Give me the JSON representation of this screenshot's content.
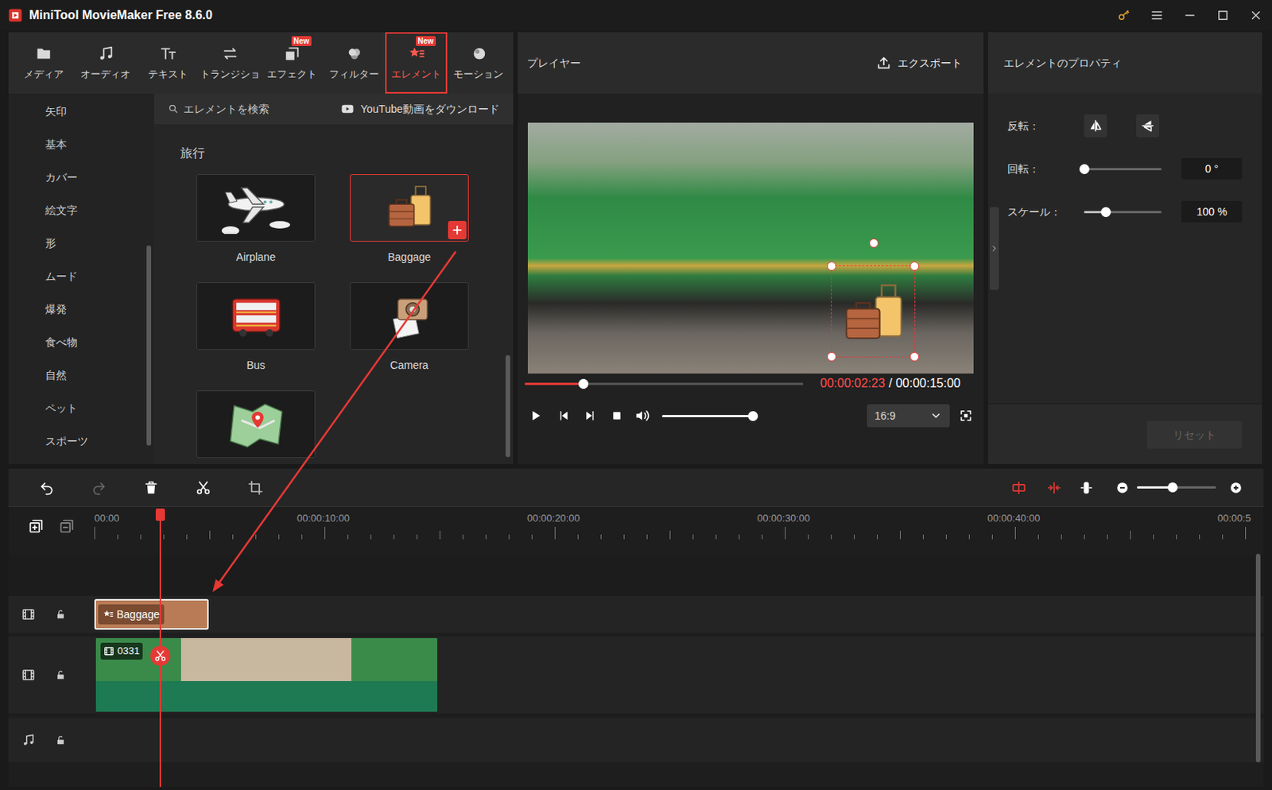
{
  "window": {
    "title": "MiniTool MovieMaker Free 8.6.0"
  },
  "toolbar": {
    "items": [
      {
        "label": "メディア",
        "selected": false
      },
      {
        "label": "オーディオ",
        "selected": false
      },
      {
        "label": "テキスト",
        "selected": false
      },
      {
        "label": "トランジショ",
        "selected": false
      },
      {
        "label": "エフェクト",
        "badge": "New",
        "selected": false
      },
      {
        "label": "フィルター",
        "selected": false
      },
      {
        "label": "エレメント",
        "badge": "New",
        "selected": true
      },
      {
        "label": "モーション",
        "selected": false
      }
    ]
  },
  "categories": {
    "items": [
      "矢印",
      "基本",
      "カバー",
      "絵文字",
      "形",
      "ムード",
      "爆発",
      "食べ物",
      "自然",
      "ペット",
      "スポーツ"
    ],
    "scroll": {
      "position": 0.41,
      "size": 0.54
    }
  },
  "library": {
    "search": {
      "placeholder": "エレメントを検索"
    },
    "download": "YouTube動画をダウンロード",
    "section": "旅行",
    "cards": [
      {
        "label": "Airplane",
        "selected": false
      },
      {
        "label": "Baggage",
        "selected": true
      },
      {
        "label": "Bus",
        "selected": false
      },
      {
        "label": "Camera",
        "selected": false
      },
      {
        "selected": false
      }
    ],
    "scroll": {
      "position": 0.68,
      "size": 0.3
    }
  },
  "player": {
    "title": "プレイヤー",
    "export": "エクスポート",
    "progress": 0.21,
    "current": "00:00:02:23",
    "total": "/ 00:00:15:00",
    "volume": 0.95,
    "aspect": "16:9"
  },
  "properties": {
    "title": "エレメントのプロパティ",
    "rows": [
      {
        "kind": "flip",
        "label": "反転："
      },
      {
        "kind": "slider",
        "label": "回転：",
        "level": 0,
        "reading": "0 °"
      },
      {
        "kind": "slider",
        "label": "スケール：",
        "level": 0.28,
        "reading": "100 %"
      }
    ],
    "reset": {
      "label": "リセット",
      "disabled": true
    }
  },
  "timeline": {
    "toolbar": {
      "undo_disabled": false,
      "redo_disabled": true
    },
    "zoom": 0.45,
    "ruler": [
      "00:00",
      "00:00:10:00",
      "00:00:20:00",
      "00:00:30:00",
      "00:00:40:00",
      "00:00:5"
    ],
    "playhead": 0.057,
    "tracks": [
      {
        "kind": "element",
        "clips": [
          {
            "label": "Baggage",
            "span": 0.099,
            "selected": true
          }
        ]
      },
      {
        "kind": "video",
        "clips": [
          {
            "label": "0331",
            "span": 0.299,
            "selected": false
          }
        ]
      },
      {
        "kind": "audio",
        "clips": []
      }
    ],
    "scroll": {
      "position": 0.167,
      "size": 0.745
    }
  }
}
